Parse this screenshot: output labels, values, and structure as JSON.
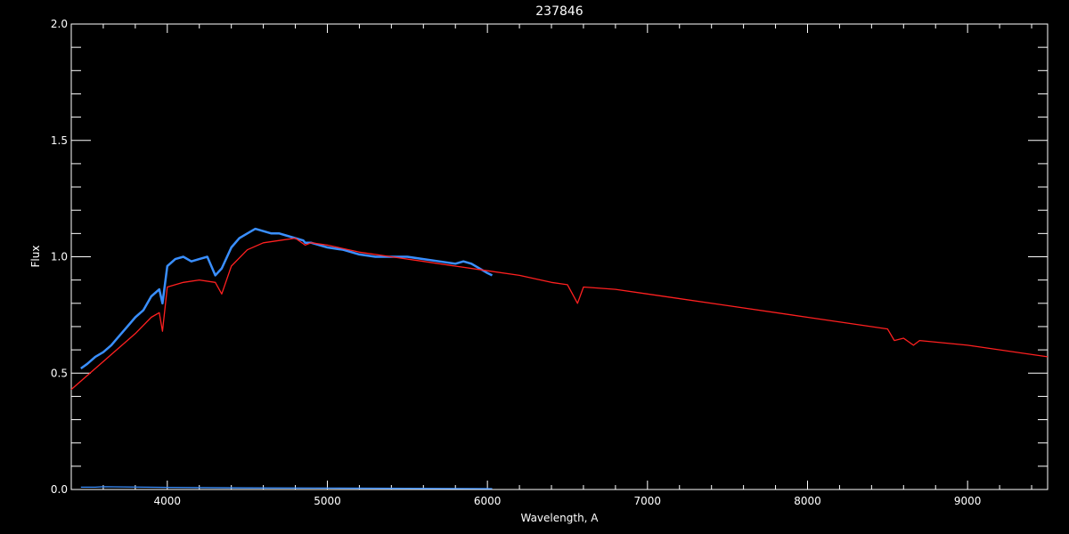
{
  "chart_data": {
    "type": "line",
    "title": "237846",
    "xlabel": "Wavelength, A",
    "ylabel": "Flux",
    "xlim": [
      3400,
      9500
    ],
    "ylim": [
      0.0,
      2.0
    ],
    "x_ticks": [
      4000,
      5000,
      6000,
      7000,
      8000,
      9000
    ],
    "x_tick_labels": [
      "4000",
      "5000",
      "6000",
      "7000",
      "8000",
      "9000"
    ],
    "y_ticks": [
      0.0,
      0.5,
      1.0,
      1.5,
      2.0
    ],
    "y_tick_labels": [
      "0.0",
      "0.5",
      "1.0",
      "1.5",
      "2.0"
    ],
    "grid": false,
    "series": [
      {
        "color": "#3a8fff",
        "kind": "observed spectrum",
        "x": [
          3460,
          3500,
          3550,
          3600,
          3650,
          3700,
          3750,
          3800,
          3850,
          3900,
          3950,
          3970,
          4000,
          4050,
          4100,
          4150,
          4200,
          4250,
          4300,
          4340,
          4400,
          4450,
          4500,
          4550,
          4600,
          4650,
          4700,
          4750,
          4800,
          4850,
          4861,
          4900,
          4950,
          5000,
          5100,
          5200,
          5300,
          5400,
          5500,
          5600,
          5700,
          5800,
          5850,
          5900,
          5950,
          6000,
          6030
        ],
        "y": [
          0.52,
          0.54,
          0.57,
          0.59,
          0.62,
          0.66,
          0.7,
          0.74,
          0.77,
          0.83,
          0.86,
          0.8,
          0.96,
          0.99,
          1.0,
          0.98,
          0.99,
          1.0,
          0.92,
          0.95,
          1.04,
          1.08,
          1.1,
          1.12,
          1.11,
          1.1,
          1.1,
          1.09,
          1.08,
          1.07,
          1.06,
          1.06,
          1.05,
          1.04,
          1.03,
          1.01,
          1.0,
          1.0,
          1.0,
          0.99,
          0.98,
          0.97,
          0.98,
          0.97,
          0.95,
          0.93,
          0.92
        ]
      },
      {
        "color": "#ff2020",
        "kind": "model fit",
        "x": [
          3400,
          3450,
          3500,
          3600,
          3700,
          3800,
          3900,
          3950,
          3970,
          4000,
          4100,
          4200,
          4300,
          4340,
          4400,
          4500,
          4600,
          4700,
          4800,
          4861,
          4900,
          5000,
          5200,
          5400,
          5600,
          5800,
          6000,
          6200,
          6400,
          6500,
          6563,
          6600,
          6800,
          7000,
          7500,
          8000,
          8500,
          8542,
          8600,
          8662,
          8700,
          9000,
          9500
        ],
        "y": [
          0.43,
          0.46,
          0.49,
          0.55,
          0.61,
          0.67,
          0.74,
          0.76,
          0.68,
          0.87,
          0.89,
          0.9,
          0.89,
          0.84,
          0.96,
          1.03,
          1.06,
          1.07,
          1.08,
          1.05,
          1.06,
          1.05,
          1.02,
          1.0,
          0.98,
          0.96,
          0.94,
          0.92,
          0.89,
          0.88,
          0.8,
          0.87,
          0.86,
          0.84,
          0.79,
          0.74,
          0.69,
          0.64,
          0.65,
          0.62,
          0.64,
          0.62,
          0.57
        ]
      },
      {
        "color": "#3a8fff",
        "kind": "error spectrum",
        "x": [
          3460,
          3550,
          3600,
          4000,
          4500,
          5000,
          5500,
          6030
        ],
        "y": [
          0.01,
          0.01,
          0.012,
          0.009,
          0.007,
          0.006,
          0.005,
          0.004
        ]
      }
    ]
  }
}
